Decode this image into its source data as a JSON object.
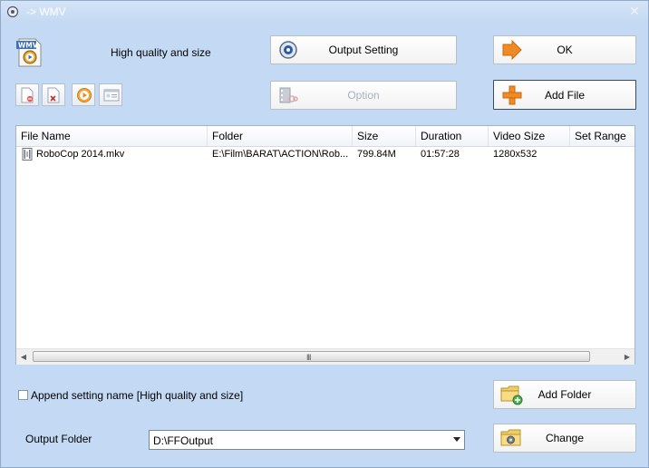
{
  "window": {
    "title": "-> WMV"
  },
  "preset": {
    "name": "High quality and size",
    "icon": "wmv-file-icon"
  },
  "toolbar": {
    "output_setting_label": "Output Setting",
    "ok_label": "OK",
    "option_label": "Option",
    "add_file_label": "Add File",
    "icons": [
      "clear-list-icon",
      "remove-item-icon",
      "play-icon",
      "info-icon"
    ]
  },
  "file_list": {
    "columns": [
      "File Name",
      "Folder",
      "Size",
      "Duration",
      "Video Size",
      "Set Range"
    ],
    "rows": [
      {
        "file_name": "RoboCop 2014.mkv",
        "folder": "E:\\Film\\BARAT\\ACTION\\Rob...",
        "size": "799.84M",
        "duration": "01:57:28",
        "video_size": "1280x532",
        "set_range": ""
      }
    ],
    "scroll_grip": "III"
  },
  "options": {
    "append_setting_label": "Append setting name [High quality and size]",
    "append_setting_checked": false,
    "add_folder_label": "Add Folder",
    "output_folder_label": "Output Folder",
    "output_folder_value": "D:\\FFOutput",
    "change_label": "Change"
  },
  "colors": {
    "window_bg": "#c4daf4",
    "accent_orange": "#f08a24",
    "title_text": "#f2f6fb"
  }
}
